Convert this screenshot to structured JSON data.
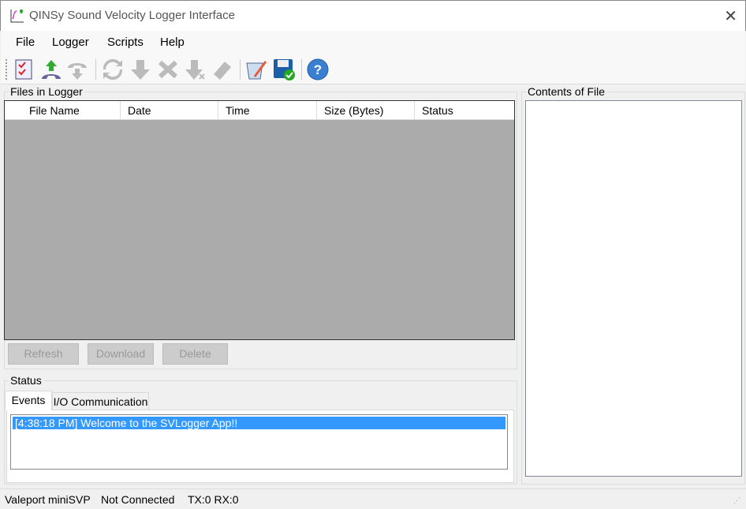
{
  "window": {
    "title": "QINSy Sound Velocity Logger Interface",
    "close_icon": "close-icon"
  },
  "menu": [
    "File",
    "Logger",
    "Scripts",
    "Help"
  ],
  "toolbar": [
    {
      "name": "checklist-icon",
      "enabled": true
    },
    {
      "name": "connect-icon",
      "enabled": true
    },
    {
      "name": "disconnect-icon",
      "enabled": false
    },
    {
      "name": "refresh-icon",
      "enabled": false
    },
    {
      "name": "download-icon",
      "enabled": false
    },
    {
      "name": "delete-icon",
      "enabled": false
    },
    {
      "name": "download-all-icon",
      "enabled": false
    },
    {
      "name": "erase-icon",
      "enabled": false
    },
    {
      "name": "edit-script-icon",
      "enabled": true
    },
    {
      "name": "save-icon",
      "enabled": true
    },
    {
      "name": "help-icon",
      "enabled": true
    }
  ],
  "files": {
    "label": "Files in Logger",
    "columns": [
      "File Name",
      "Date",
      "Time",
      "Size (Bytes)",
      "Status"
    ],
    "rows": [],
    "buttons": {
      "refresh": "Refresh",
      "download": "Download",
      "delete": "Delete"
    }
  },
  "status": {
    "label": "Status",
    "tabs": [
      "Events",
      "I/O Communication"
    ],
    "active_tab": "Events",
    "events": [
      "[4:38:18 PM] Welcome to the SVLogger App!!"
    ]
  },
  "contents": {
    "label": "Contents of File"
  },
  "statusbar": {
    "device": "Valeport miniSVP",
    "connection": "Not Connected",
    "txrx": "TX:0 RX:0"
  },
  "colors": {
    "selection": "#3399ff",
    "table_bg": "#ababab"
  }
}
